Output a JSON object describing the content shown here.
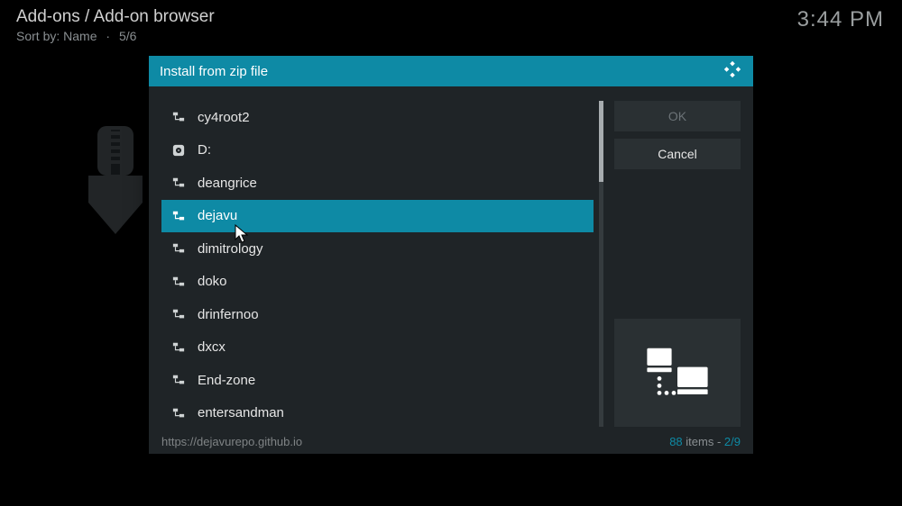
{
  "header": {
    "title": "Add-ons / Add-on browser",
    "sort_label": "Sort by:",
    "sort_field": "Name",
    "position": "5/6"
  },
  "clock": "3:44 PM",
  "dialog": {
    "title": "Install from zip file",
    "buttons": {
      "ok": "OK",
      "cancel": "Cancel"
    },
    "items": [
      {
        "label": "cy4root2",
        "icon": "network",
        "selected": false
      },
      {
        "label": "D:",
        "icon": "disk",
        "selected": false
      },
      {
        "label": "deangrice",
        "icon": "network",
        "selected": false
      },
      {
        "label": "dejavu",
        "icon": "network",
        "selected": true
      },
      {
        "label": "dimitrology",
        "icon": "network",
        "selected": false
      },
      {
        "label": "doko",
        "icon": "network",
        "selected": false
      },
      {
        "label": "drinfernoo",
        "icon": "network",
        "selected": false
      },
      {
        "label": "dxcx",
        "icon": "network",
        "selected": false
      },
      {
        "label": "End-zone",
        "icon": "network",
        "selected": false
      },
      {
        "label": "entersandman",
        "icon": "network",
        "selected": false
      }
    ],
    "footer": {
      "path": "https://dejavurepo.github.io",
      "count": "88",
      "items_label": "items",
      "position": "2/9"
    }
  }
}
